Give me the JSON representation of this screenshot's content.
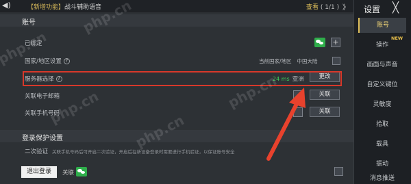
{
  "topbar": {
    "announcement_tag": "【新增功能】",
    "announcement_text": "战斗辅助语音",
    "view_label": "查看",
    "page_count": "( 1/1 )",
    "collapse_label": "》"
  },
  "account": {
    "section_title": "账号",
    "binding_label": "已绑定",
    "region_label": "国家/地区设置",
    "region_current_label": "当前国家/地区",
    "region_value": "中国大陆",
    "server_label": "服务器选择",
    "ping": "24 ms",
    "server_value": "亚洲",
    "change_button": "更改",
    "email_label": "关联电子邮箱",
    "email_button": "关联",
    "phone_label": "关联手机号码",
    "phone_button": "关联"
  },
  "login_protection": {
    "section_title": "登录保护设置",
    "two_step_label": "二次验证",
    "two_step_desc": "关联手机号码后可开启二次验证，开启后在新设备登录时需要进行手机验证，以保证账号安全"
  },
  "footer": {
    "logout_button": "退出登录",
    "linked_label": "关联"
  },
  "sidebar": {
    "title": "设置",
    "close_label": "╳",
    "items": [
      {
        "label": "账号",
        "active": true
      },
      {
        "label": "操作",
        "new": true
      },
      {
        "label": "画面与声音"
      },
      {
        "label": "自定义键位"
      },
      {
        "label": "灵敏度"
      },
      {
        "label": "拾取"
      },
      {
        "label": "载具"
      },
      {
        "label": "振动"
      },
      {
        "label": "消息推送"
      }
    ],
    "new_badge": "NEW"
  },
  "watermark_text": "php.cn",
  "colors": {
    "accent": "#e0c05a",
    "highlight_border": "#d8382a",
    "wechat": "#2fae4b",
    "arrow": "#e8422d"
  }
}
